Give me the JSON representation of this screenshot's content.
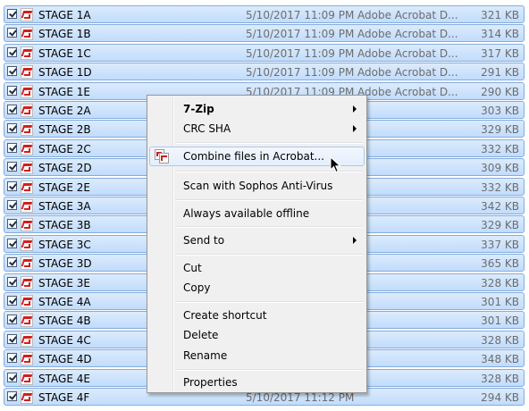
{
  "files": [
    {
      "name": "STAGE 1A",
      "date": "5/10/2017 11:09 PM",
      "type": "Adobe Acrobat D...",
      "size": "321 KB"
    },
    {
      "name": "STAGE 1B",
      "date": "5/10/2017 11:09 PM",
      "type": "Adobe Acrobat D...",
      "size": "314 KB"
    },
    {
      "name": "STAGE 1C",
      "date": "5/10/2017 11:09 PM",
      "type": "Adobe Acrobat D...",
      "size": "317 KB"
    },
    {
      "name": "STAGE 1D",
      "date": "5/10/2017 11:09 PM",
      "type": "Adobe Acrobat D...",
      "size": "291 KB"
    },
    {
      "name": "STAGE 1E",
      "date": "5/10/2017 11:09 PM",
      "type": "Adobe Acrobat D...",
      "size": "290 KB"
    },
    {
      "name": "STAGE 2A",
      "date": "",
      "type": "",
      "size": "303 KB"
    },
    {
      "name": "STAGE 2B",
      "date": "",
      "type": "",
      "size": "329 KB"
    },
    {
      "name": "STAGE 2C",
      "date": "",
      "type": "",
      "size": "332 KB"
    },
    {
      "name": "STAGE 2D",
      "date": "",
      "type": "",
      "size": "309 KB"
    },
    {
      "name": "STAGE 2E",
      "date": "",
      "type": "",
      "size": "332 KB"
    },
    {
      "name": "STAGE 3A",
      "date": "",
      "type": "",
      "size": "342 KB"
    },
    {
      "name": "STAGE 3B",
      "date": "",
      "type": "",
      "size": "329 KB"
    },
    {
      "name": "STAGE 3C",
      "date": "",
      "type": "",
      "size": "337 KB"
    },
    {
      "name": "STAGE 3D",
      "date": "",
      "type": "",
      "size": "365 KB"
    },
    {
      "name": "STAGE 3E",
      "date": "",
      "type": "",
      "size": "328 KB"
    },
    {
      "name": "STAGE 4A",
      "date": "",
      "type": "",
      "size": "301 KB"
    },
    {
      "name": "STAGE 4B",
      "date": "",
      "type": "",
      "size": "301 KB"
    },
    {
      "name": "STAGE 4C",
      "date": "",
      "type": "",
      "size": "328 KB"
    },
    {
      "name": "STAGE 4D",
      "date": "",
      "type": "",
      "size": "348 KB"
    },
    {
      "name": "STAGE 4E",
      "date": "",
      "type": "",
      "size": "328 KB"
    },
    {
      "name": "STAGE 4F",
      "date": "5/10/2017 11:12 PM",
      "type": "",
      "size": "294 KB"
    }
  ],
  "context_menu": {
    "items": [
      {
        "label": "7-Zip",
        "bold": true,
        "submenu": true
      },
      {
        "label": "CRC SHA",
        "submenu": true
      },
      {
        "label": "Combine files in Acrobat...",
        "icon": "acrobat-combine-icon",
        "highlighted": true
      },
      {
        "label": "Scan with Sophos Anti-Virus"
      },
      {
        "label": "Always available offline"
      },
      {
        "label": "Send to",
        "submenu": true
      },
      {
        "label": "Cut"
      },
      {
        "label": "Copy"
      },
      {
        "label": "Create shortcut"
      },
      {
        "label": "Delete"
      },
      {
        "label": "Rename"
      },
      {
        "label": "Properties"
      }
    ]
  },
  "colors": {
    "selection_fill": "#c9e0fc",
    "selection_border": "#84acdd",
    "pdf_red": "#d31f1f",
    "menu_background": "#f0f0f0"
  }
}
